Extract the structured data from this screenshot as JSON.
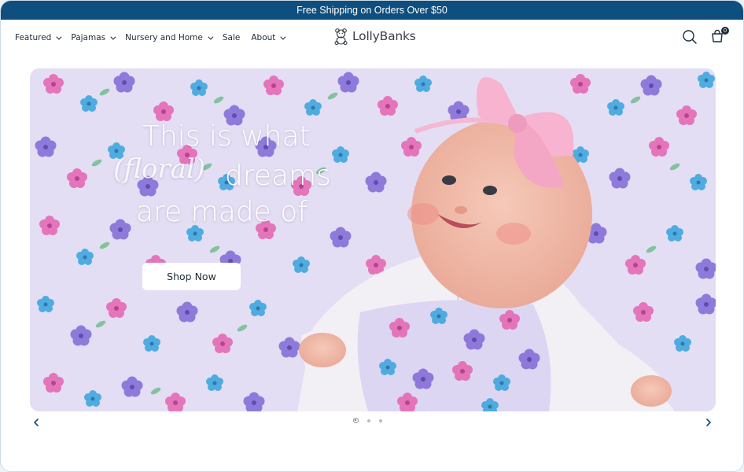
{
  "announcement": {
    "text": "Free Shipping on Orders Over $50"
  },
  "nav": {
    "items": [
      {
        "label": "Featured",
        "has_dropdown": true
      },
      {
        "label": "Pajamas",
        "has_dropdown": true
      },
      {
        "label": "Nursery and Home",
        "has_dropdown": true
      },
      {
        "label": "Sale",
        "has_dropdown": false
      },
      {
        "label": "About",
        "has_dropdown": true
      }
    ]
  },
  "logo": {
    "text": "LollyBanks",
    "icon": "teddy-bear-icon"
  },
  "actions": {
    "search_icon": "search-icon",
    "cart_icon": "shopping-bag-icon",
    "cart_count": "0"
  },
  "hero": {
    "line1": "This is what",
    "line2_script": "(floral)",
    "line2_rest": "dreams",
    "line3": "are made of",
    "cta_label": "Shop Now",
    "image_description_icon": "baby-on-floral-blanket-image"
  },
  "carousel": {
    "prev_icon": "chevron-left-icon",
    "next_icon": "chevron-right-icon",
    "slide_count": 3,
    "active_slide": 1
  },
  "colors": {
    "announcement_bg": "#0f4f7f",
    "text_dark": "#1e2b3a",
    "arrow": "#0f4f7f"
  }
}
